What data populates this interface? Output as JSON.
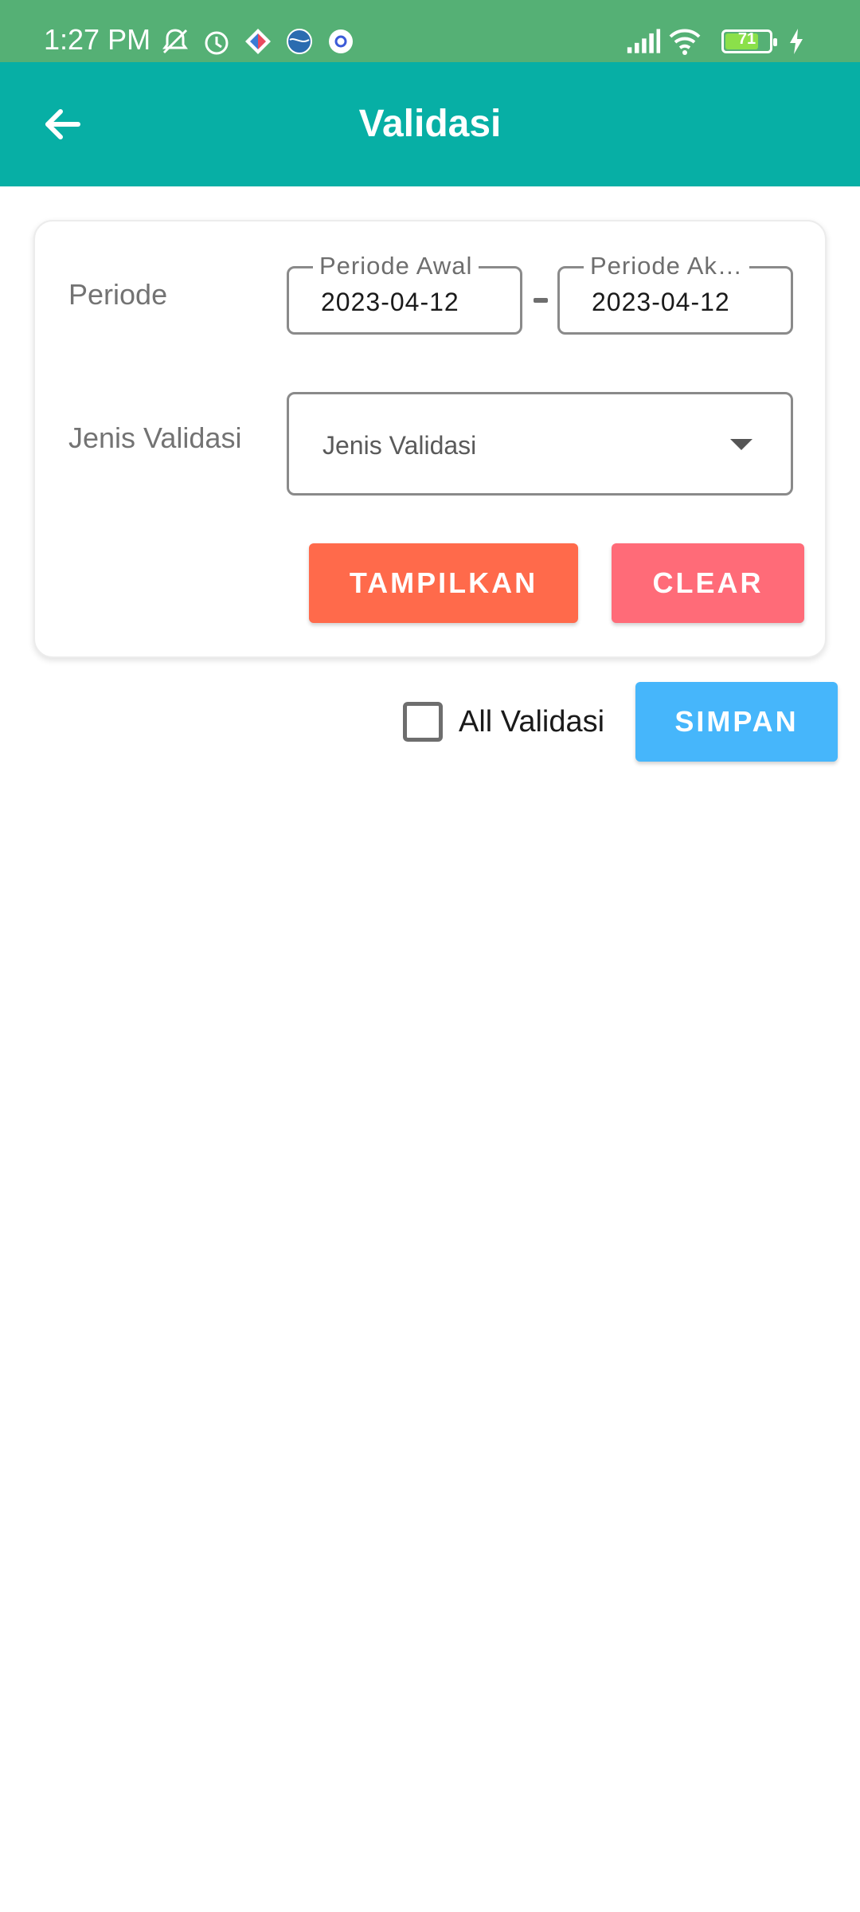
{
  "status_bar": {
    "time": "1:27 PM",
    "battery_level": "71",
    "icons_left": [
      "notifications-muted-icon",
      "alarm-icon",
      "app-diamond-icon",
      "globe-app-icon",
      "settings-app-icon"
    ],
    "icons_right": [
      "signal-icon",
      "wifi-icon",
      "battery-icon",
      "charging-icon"
    ]
  },
  "app_bar": {
    "title": "Validasi",
    "back_icon": "arrow-left-icon",
    "background_color": "#07afa5"
  },
  "filter": {
    "periode_label": "Periode",
    "periode_awal": {
      "label": "Periode Awal",
      "value": "2023-04-12"
    },
    "periode_akhir": {
      "label": "Periode Ak…",
      "value": "2023-04-12"
    },
    "jenis_label": "Jenis Validasi",
    "jenis_select": {
      "placeholder": "Jenis Validasi"
    },
    "tampilkan_button": "TAMPILKAN",
    "clear_button": "CLEAR"
  },
  "actions": {
    "all_validasi_label": "All Validasi",
    "all_validasi_checked": false,
    "simpan_button": "SIMPAN"
  },
  "colors": {
    "status_bar": "#55b075",
    "tampilkan": "#ff6a4b",
    "clear": "#ff6b78",
    "simpan": "#46b6fb"
  }
}
